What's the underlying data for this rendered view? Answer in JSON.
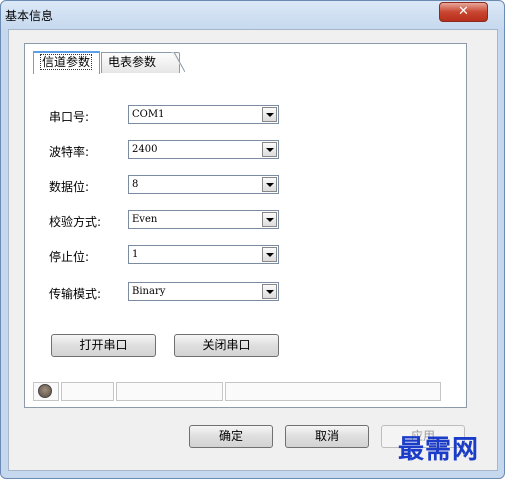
{
  "window": {
    "title": "基本信息",
    "close_symbol": "✕"
  },
  "tabs": [
    {
      "label": "信道参数",
      "active": true
    },
    {
      "label": "电表参数",
      "active": false
    }
  ],
  "fields": [
    {
      "label": "串口号:",
      "value": "COM1"
    },
    {
      "label": "波特率:",
      "value": "2400"
    },
    {
      "label": "数据位:",
      "value": "8"
    },
    {
      "label": "校验方式:",
      "value": "Even"
    },
    {
      "label": "停止位:",
      "value": "1"
    },
    {
      "label": "传输模式:",
      "value": "Binary"
    }
  ],
  "buttons": {
    "open_port": "打开串口",
    "close_port": "关闭串口",
    "ok": "确定",
    "cancel": "取消",
    "apply": "应用"
  },
  "watermark": "最需网",
  "colors": {
    "close_button": "#c8452f",
    "active_tab_accent": "#5aa0e6",
    "watermark": "#1a3cc8"
  }
}
